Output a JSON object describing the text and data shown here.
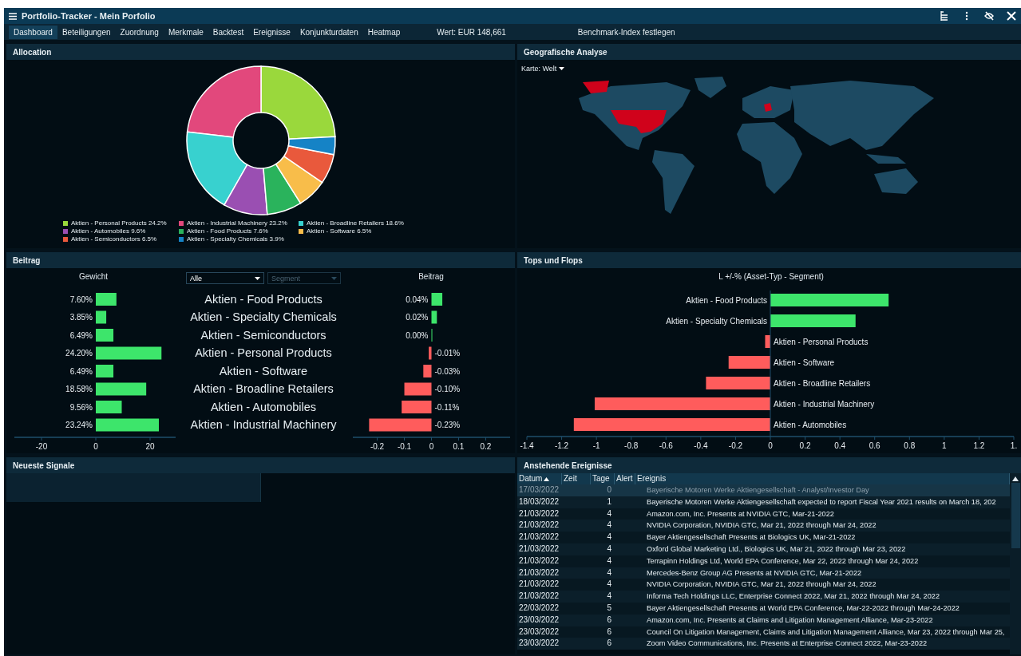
{
  "window": {
    "title": "Portfolio-Tracker - Mein Porfolio"
  },
  "tabs": [
    {
      "label": "Dashboard",
      "selected": true
    },
    {
      "label": "Beteiligungen",
      "selected": false
    },
    {
      "label": "Zuordnung",
      "selected": false
    },
    {
      "label": "Merkmale",
      "selected": false
    },
    {
      "label": "Backtest",
      "selected": false
    },
    {
      "label": "Ereignisse",
      "selected": false
    },
    {
      "label": "Konjunkturdaten",
      "selected": false
    },
    {
      "label": "Heatmap",
      "selected": false
    }
  ],
  "portfolio_value": {
    "label": "Wert:",
    "value": "EUR 148,661"
  },
  "benchmark_button": {
    "label": "Benchmark-Index festlegen"
  },
  "allocation": {
    "title": "Allocation",
    "chart_data": {
      "type": "donut",
      "categories": [
        "Aktien - Personal Products",
        "Aktien - Industrial Machinery",
        "Aktien - Broadline Retailers",
        "Aktien - Automobiles",
        "Aktien - Food Products",
        "Aktien - Software",
        "Aktien - Semiconductors",
        "Aktien - Specialty Chemicals"
      ],
      "values": [
        24.2,
        23.2,
        18.6,
        9.6,
        7.6,
        6.5,
        6.5,
        3.9
      ]
    },
    "legend": [
      {
        "value_label": "24.2%",
        "color": "#9ad83c"
      },
      {
        "value_label": "23.2%",
        "color": "#e2487c"
      },
      {
        "value_label": "18.6%",
        "color": "#38d1cf"
      },
      {
        "value_label": "9.6%",
        "color": "#9a4fb2"
      },
      {
        "value_label": "7.6%",
        "color": "#2ab35c"
      },
      {
        "value_label": "6.5%",
        "color": "#f8bd4a"
      },
      {
        "value_label": "6.5%",
        "color": "#e9593c"
      },
      {
        "value_label": "3.9%",
        "color": "#1583c6"
      }
    ]
  },
  "geo": {
    "title": "Geografische Analyse",
    "map_selector": {
      "value": "Karte: Welt"
    }
  },
  "beitrag": {
    "title": "Beitrag",
    "type_filter": {
      "value": "Alle"
    },
    "segment_filter": {
      "placeholder": "Segment",
      "disabled": true
    },
    "segments": [
      "Aktien - Food Products",
      "Aktien - Specialty Chemicals",
      "Aktien - Semiconductors",
      "Aktien - Personal Products",
      "Aktien - Software",
      "Aktien - Broadline Retailers",
      "Aktien - Automobiles",
      "Aktien - Industrial Machinery"
    ],
    "weight_chart": {
      "chart_data": {
        "type": "bar",
        "orientation": "horizontal",
        "title": "Gewicht",
        "series": [
          {
            "color": "#3de56b",
            "values": [
              7.6,
              3.85,
              6.49,
              24.2,
              6.49,
              18.58,
              9.56,
              23.24
            ]
          }
        ],
        "xlim": [
          -30,
          30
        ],
        "xticks": [
          -20,
          0,
          20
        ],
        "value_labels": [
          "7.60%",
          "3.85%",
          "6.49%",
          "24.20%",
          "6.49%",
          "18.58%",
          "9.56%",
          "23.24%"
        ]
      }
    },
    "contribution_chart": {
      "chart_data": {
        "type": "bar",
        "orientation": "horizontal",
        "title": "Beitrag",
        "series": [
          {
            "color": "#3de56b",
            "values": [
              0.04,
              0.02,
              0.0,
              null,
              null,
              null,
              null,
              null
            ]
          },
          {
            "color": "#ff5c5c",
            "values": [
              null,
              null,
              null,
              -0.01,
              -0.03,
              -0.1,
              -0.11,
              -0.23
            ]
          }
        ],
        "xlim": [
          -0.29,
          0.29
        ],
        "xticks": [
          -0.2,
          -0.1,
          0,
          0.1,
          0.2
        ],
        "value_labels": [
          "0.04%",
          "0.02%",
          "0.00%",
          "-0.01%",
          "-0.03%",
          "-0.10%",
          "-0.11%",
          "-0.23%"
        ]
      }
    }
  },
  "tops_flops": {
    "title": "Tops und Flops",
    "chart_data": {
      "type": "bar",
      "orientation": "horizontal",
      "title": "L +/-% (Asset-Typ - Segment)",
      "categories": [
        "Aktien - Food Products",
        "Aktien - Specialty Chemicals",
        "Aktien - Personal Products",
        "Aktien - Software",
        "Aktien - Broadline Retailers",
        "Aktien - Industrial Machinery",
        "Aktien - Automobiles"
      ],
      "series": [
        {
          "color": "#3de56b",
          "values": [
            0.68,
            0.49,
            null,
            null,
            null,
            null,
            null
          ]
        },
        {
          "color": "#ff5c5c",
          "values": [
            null,
            null,
            -0.03,
            -0.24,
            -0.37,
            -1.01,
            -1.13
          ]
        }
      ],
      "xlim": [
        -1.4,
        1.4
      ],
      "xticks": [
        -1.4,
        -1.2,
        -1,
        -0.8,
        -0.6,
        -0.4,
        -0.2,
        0,
        0.2,
        0.4,
        0.6,
        0.8,
        1,
        1.2,
        {
          "value": 1.4,
          "label": "1."
        }
      ]
    }
  },
  "signals": {
    "title": "Neueste Signale"
  },
  "events": {
    "title": "Anstehende Ereignisse",
    "columns": [
      {
        "label": "Datum",
        "sorted": true
      },
      {
        "label": "Zeit",
        "sorted": false
      },
      {
        "label": "Tage",
        "sorted": false
      },
      {
        "label": "Alert",
        "sorted": false
      },
      {
        "label": "Ereignis",
        "sorted": false
      }
    ],
    "rows": [
      {
        "datum": "17/03/2022",
        "tage": "0",
        "ereignis": "Bayerische Motoren Werke Aktiengesellschaft - Analyst/Investor Day",
        "selected": true
      },
      {
        "datum": "18/03/2022",
        "tage": "1",
        "ereignis": "Bayerische Motoren Werke Aktiengesellschaft expected to report Fiscal Year 2021 results on March 18, 202",
        "selected": false
      },
      {
        "datum": "21/03/2022",
        "tage": "4",
        "ereignis": "Amazon.com, Inc. Presents at NVIDIA GTC, Mar-21-2022",
        "selected": false
      },
      {
        "datum": "21/03/2022",
        "tage": "4",
        "ereignis": "NVIDIA Corporation, NVIDIA GTC, Mar 21, 2022 through Mar 24, 2022",
        "selected": false
      },
      {
        "datum": "21/03/2022",
        "tage": "4",
        "ereignis": "Bayer Aktiengesellschaft Presents at Biologics UK, Mar-21-2022",
        "selected": false
      },
      {
        "datum": "21/03/2022",
        "tage": "4",
        "ereignis": "Oxford Global Marketing Ltd., Biologics UK, Mar 21, 2022 through Mar 23, 2022",
        "selected": false
      },
      {
        "datum": "21/03/2022",
        "tage": "4",
        "ereignis": "Terrapinn Holdings Ltd, World EPA Conference, Mar 22, 2022 through Mar 24, 2022",
        "selected": false
      },
      {
        "datum": "21/03/2022",
        "tage": "4",
        "ereignis": "Mercedes-Benz Group AG Presents at NVIDIA GTC, Mar-21-2022",
        "selected": false
      },
      {
        "datum": "21/03/2022",
        "tage": "4",
        "ereignis": "NVIDIA Corporation, NVIDIA GTC, Mar 21, 2022 through Mar 24, 2022",
        "selected": false
      },
      {
        "datum": "21/03/2022",
        "tage": "4",
        "ereignis": "Informa Tech Holdings LLC, Enterprise Connect 2022, Mar 21, 2022 through Mar 24, 2022",
        "selected": false
      },
      {
        "datum": "22/03/2022",
        "tage": "5",
        "ereignis": "Bayer Aktiengesellschaft Presents at World EPA Conference, Mar-22-2022 through Mar-24-2022",
        "selected": false
      },
      {
        "datum": "23/03/2022",
        "tage": "6",
        "ereignis": "Amazon.com, Inc. Presents at Claims and Litigation Management Alliance, Mar-23-2022",
        "selected": false
      },
      {
        "datum": "23/03/2022",
        "tage": "6",
        "ereignis": "Council On Litigation Management, Claims and Litigation Management Alliance, Mar 23, 2022 through Mar 25,",
        "selected": false
      },
      {
        "datum": "23/03/2022",
        "tage": "6",
        "ereignis": "Zoom Video Communications, Inc. Presents at Enterprise Connect 2022, Mar-23-2022",
        "selected": false
      }
    ]
  }
}
